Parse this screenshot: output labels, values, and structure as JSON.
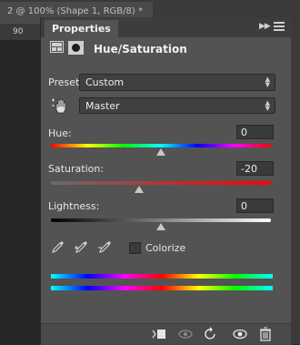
{
  "document": {
    "tab_title": "2 @ 100% (Shape 1, RGB/8) *",
    "ruler_label": "90"
  },
  "panel": {
    "tab": "Properties",
    "title": "Hue/Saturation",
    "preset": {
      "label": "Preset:",
      "value": "Custom"
    },
    "channel": {
      "value": "Master"
    },
    "hue": {
      "label": "Hue:",
      "value": "0",
      "level": 0.5
    },
    "saturation": {
      "label": "Saturation:",
      "value": "-20",
      "level": 0.4
    },
    "lightness": {
      "label": "Lightness:",
      "value": "0",
      "level": 0.5
    },
    "colorize": {
      "label": "Colorize",
      "checked": false
    }
  },
  "icons": [
    "adjustment-layer-icon",
    "mask-icon",
    "targeted-adjustment-hand-icon",
    "eyedropper-icon",
    "add-to-sample-eyedropper-icon",
    "subtract-from-sample-eyedropper-icon",
    "clip-to-layer-icon",
    "view-previous-state-icon",
    "reset-icon",
    "visibility-eye-icon",
    "trash-icon",
    "collapse-icon",
    "panel-menu-icon"
  ],
  "colors": {
    "panel_bg": "#535353",
    "tab_bar_bg": "#3d3d3d",
    "field_bg": "#404040",
    "text": "#e6e6e6"
  }
}
